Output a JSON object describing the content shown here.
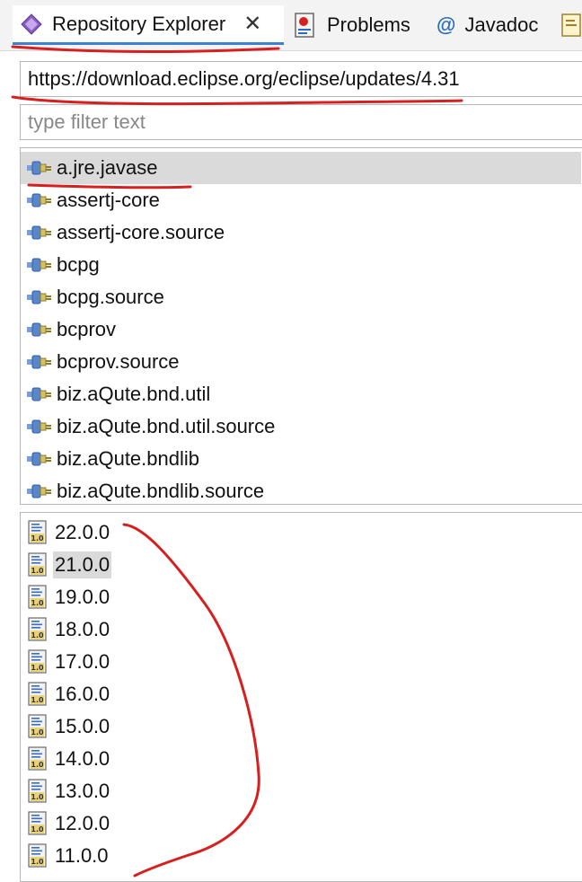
{
  "tabs": [
    {
      "label": "Repository Explorer",
      "icon": "repository-icon",
      "active": true
    },
    {
      "label": "Problems",
      "icon": "problems-icon",
      "active": false
    },
    {
      "label": "Javadoc",
      "icon": "at-icon",
      "active": false
    },
    {
      "label": "",
      "icon": "declaration-icon",
      "active": false
    }
  ],
  "url_field": {
    "value": "https://download.eclipse.org/eclipse/updates/4.31"
  },
  "filter_field": {
    "placeholder": "type filter text"
  },
  "units": [
    "a.jre.javase",
    "assertj-core",
    "assertj-core.source",
    "bcpg",
    "bcpg.source",
    "bcprov",
    "bcprov.source",
    "biz.aQute.bnd.util",
    "biz.aQute.bnd.util.source",
    "biz.aQute.bndlib",
    "biz.aQute.bndlib.source"
  ],
  "selected_unit": "a.jre.javase",
  "versions": [
    "22.0.0",
    "21.0.0",
    "19.0.0",
    "18.0.0",
    "17.0.0",
    "16.0.0",
    "15.0.0",
    "14.0.0",
    "13.0.0",
    "12.0.0",
    "11.0.0"
  ],
  "selected_version": "21.0.0",
  "version_icon_text": "1.0",
  "colors": {
    "annotation": "#d62020",
    "selection": "#dadada",
    "active_tab_underline": "#3b82d6"
  }
}
